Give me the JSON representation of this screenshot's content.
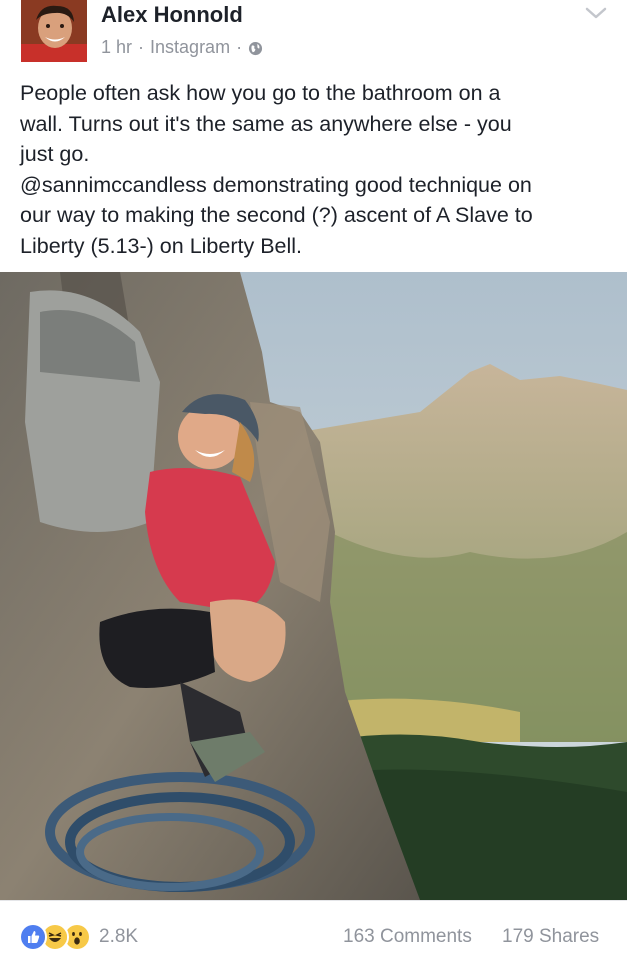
{
  "post": {
    "author": "Alex Honnold",
    "time": "1 hr",
    "separator": "·",
    "source": "Instagram",
    "privacy_icon": "globe-icon",
    "text_lines": [
      "People often ask how you go to the bathroom on a",
      "wall. Turns out it's the same as anywhere else - you",
      "just go.",
      "@sannimccandless demonstrating good technique on",
      "our way to making the second (?) ascent of A Slave to",
      "Liberty (5.13-) on Liberty Bell."
    ]
  },
  "footer": {
    "reaction_icons": [
      "like-icon",
      "haha-icon",
      "wow-icon"
    ],
    "reaction_count": "2.8K",
    "comments": "163 Comments",
    "shares": "179 Shares"
  },
  "colors": {
    "text": "#1d2129",
    "meta": "#90949c",
    "like_blue": "#4f7ef0",
    "emoji_yellow": "#f7c948"
  }
}
